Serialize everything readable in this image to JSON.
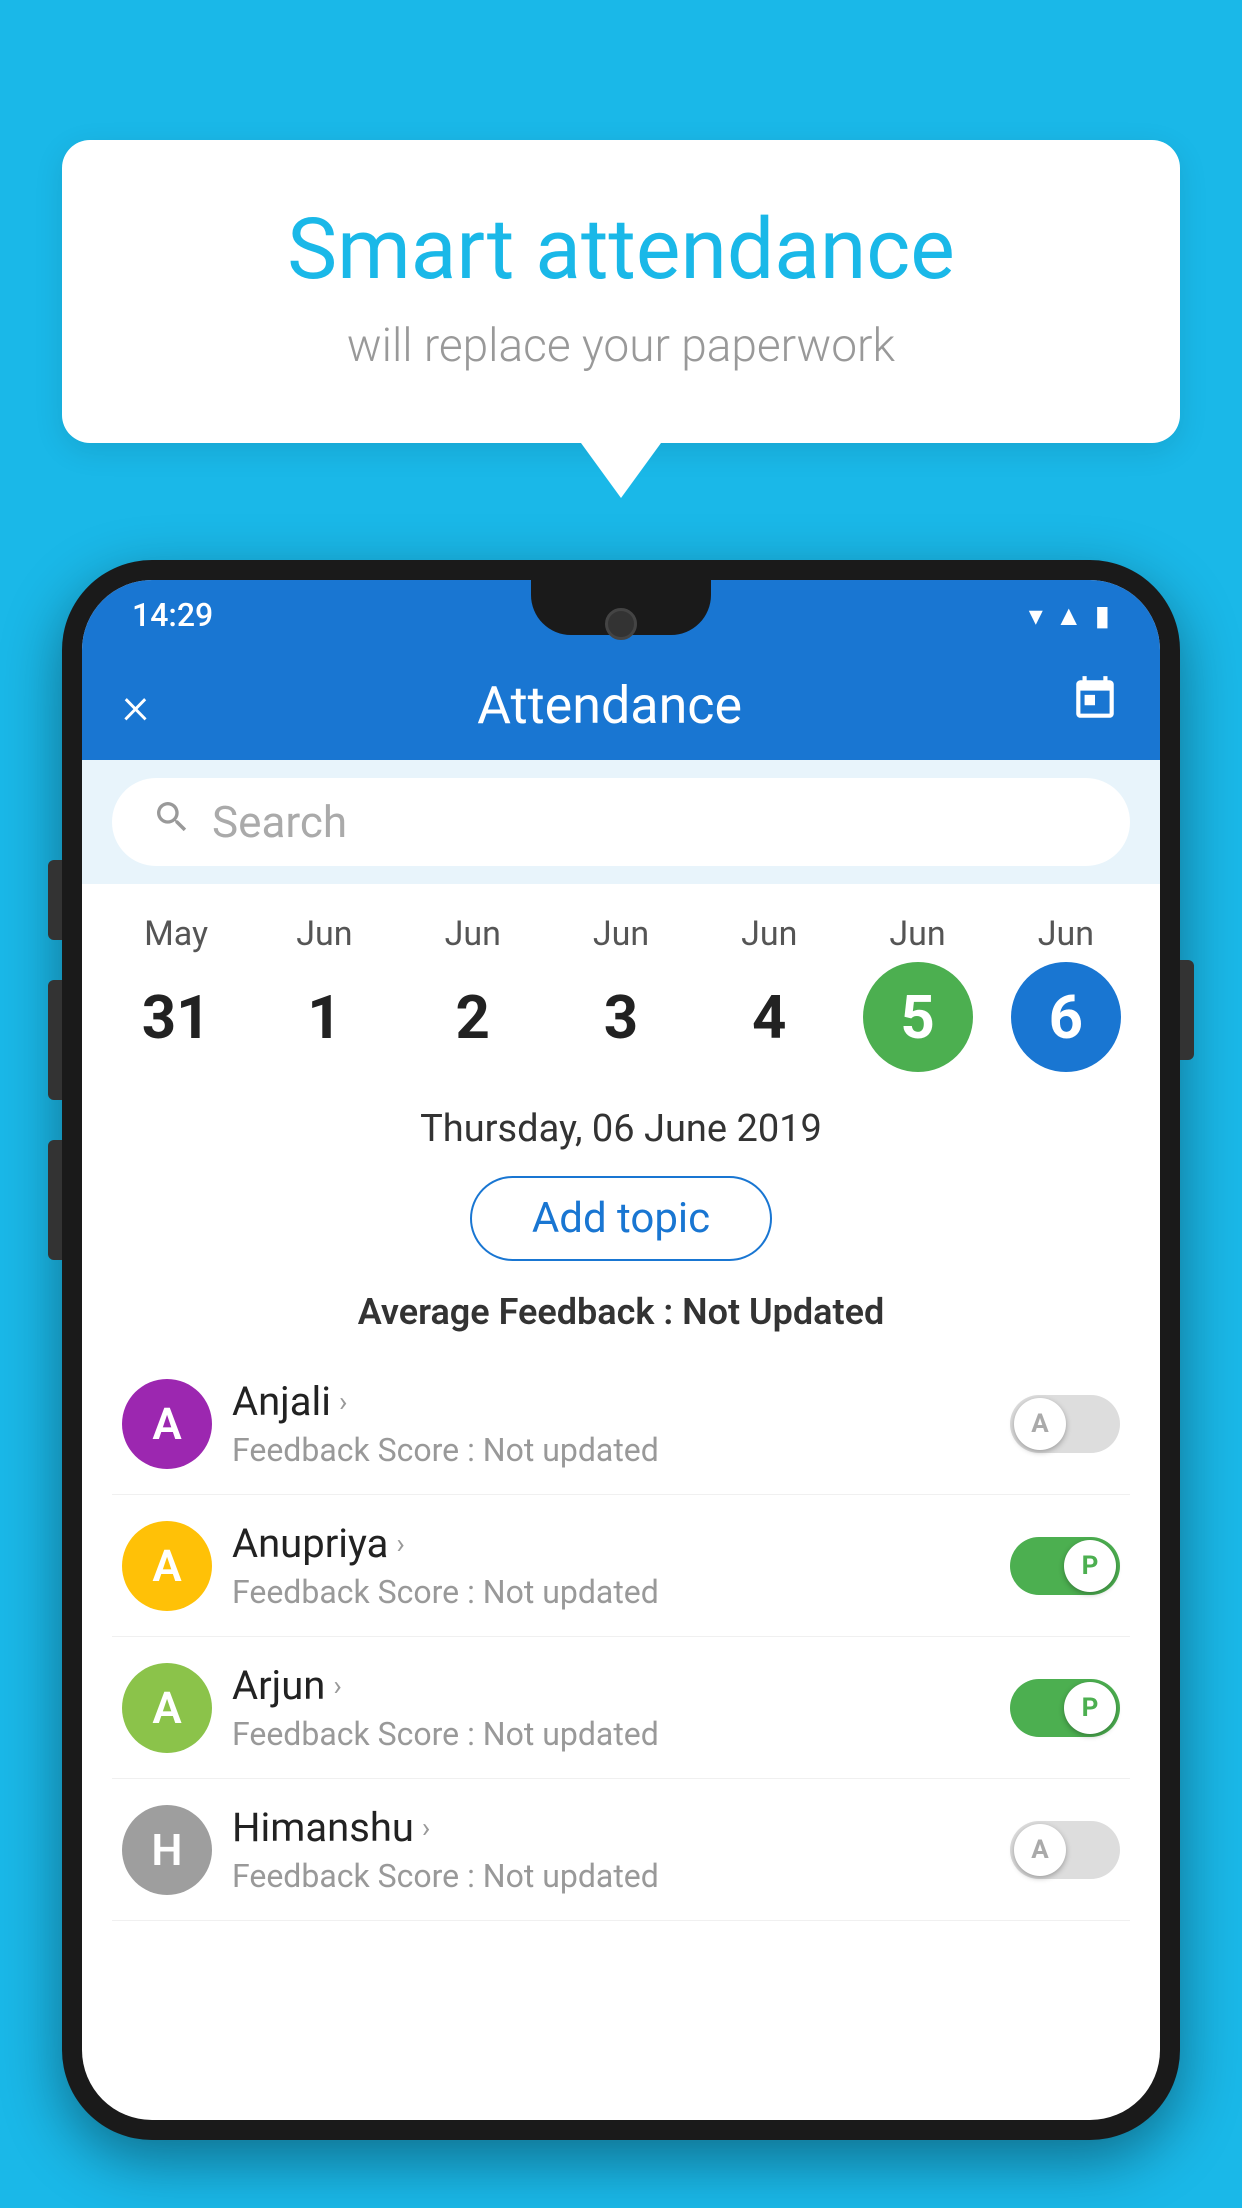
{
  "background_color": "#1ab8e8",
  "speech_bubble": {
    "title": "Smart attendance",
    "subtitle": "will replace your paperwork"
  },
  "status_bar": {
    "time": "14:29",
    "icons": [
      "wifi",
      "signal",
      "battery"
    ]
  },
  "app_bar": {
    "title": "Attendance",
    "close_label": "×",
    "calendar_icon": "📅"
  },
  "search": {
    "placeholder": "Search"
  },
  "calendar": {
    "days": [
      {
        "month": "May",
        "date": "31",
        "state": "normal"
      },
      {
        "month": "Jun",
        "date": "1",
        "state": "normal"
      },
      {
        "month": "Jun",
        "date": "2",
        "state": "normal"
      },
      {
        "month": "Jun",
        "date": "3",
        "state": "normal"
      },
      {
        "month": "Jun",
        "date": "4",
        "state": "normal"
      },
      {
        "month": "Jun",
        "date": "5",
        "state": "today"
      },
      {
        "month": "Jun",
        "date": "6",
        "state": "selected"
      }
    ]
  },
  "selected_date_label": "Thursday, 06 June 2019",
  "add_topic_label": "Add topic",
  "avg_feedback_label": "Average Feedback : ",
  "avg_feedback_value": "Not Updated",
  "students": [
    {
      "name": "Anjali",
      "avatar_letter": "A",
      "avatar_color": "#9c27b0",
      "feedback_label": "Feedback Score : ",
      "feedback_value": "Not updated",
      "attendance_state": "off",
      "attendance_letter": "A"
    },
    {
      "name": "Anupriya",
      "avatar_letter": "A",
      "avatar_color": "#ffc107",
      "feedback_label": "Feedback Score : ",
      "feedback_value": "Not updated",
      "attendance_state": "on",
      "attendance_letter": "P"
    },
    {
      "name": "Arjun",
      "avatar_letter": "A",
      "avatar_color": "#8bc34a",
      "feedback_label": "Feedback Score : ",
      "feedback_value": "Not updated",
      "attendance_state": "on",
      "attendance_letter": "P"
    },
    {
      "name": "Himanshu",
      "avatar_letter": "H",
      "avatar_color": "#9e9e9e",
      "feedback_label": "Feedback Score : ",
      "feedback_value": "Not updated",
      "attendance_state": "off",
      "attendance_letter": "A"
    }
  ]
}
